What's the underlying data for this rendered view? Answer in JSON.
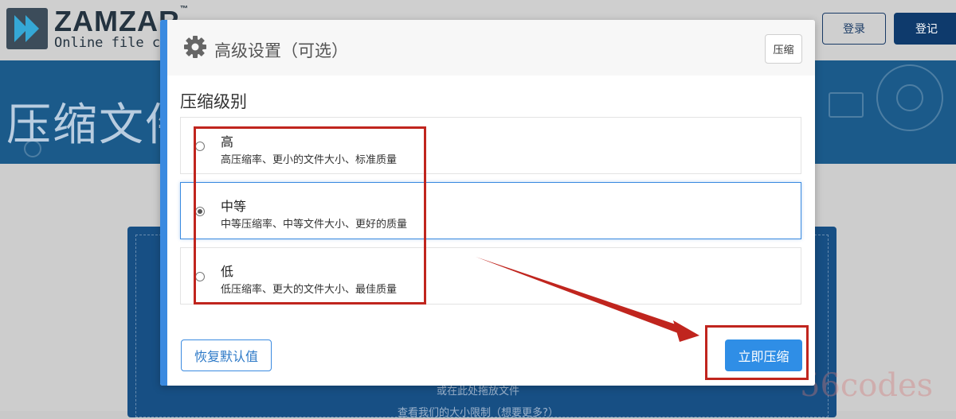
{
  "site": {
    "brand": "ZAMZAR",
    "trademark": "™",
    "tagline": "Online file conve",
    "login_label": "登录",
    "register_label": "登记",
    "hero_title": "压缩文件",
    "drop_hint": "或在此处拖放文件",
    "size_limit_hint": "查看我们的大小限制（想要更多?）"
  },
  "modal": {
    "icon": "gear-icon",
    "title": "高级设置（可选）",
    "header_button_label": "压缩",
    "section_label": "压缩级别",
    "options": [
      {
        "title": "高",
        "description": "高压缩率、更小的文件大小、标准质量",
        "selected": false
      },
      {
        "title": "中等",
        "description": "中等压缩率、中等文件大小、更好的质量",
        "selected": true
      },
      {
        "title": "低",
        "description": "低压缩率、更大的文件大小、最佳质量",
        "selected": false
      }
    ],
    "reset_label": "恢复默认值",
    "compress_label": "立即压缩"
  },
  "watermark": "56codes",
  "colors": {
    "accent_blue": "#2f8ee6",
    "annotation_red": "#c0251e",
    "navy": "#0e3a6c"
  }
}
